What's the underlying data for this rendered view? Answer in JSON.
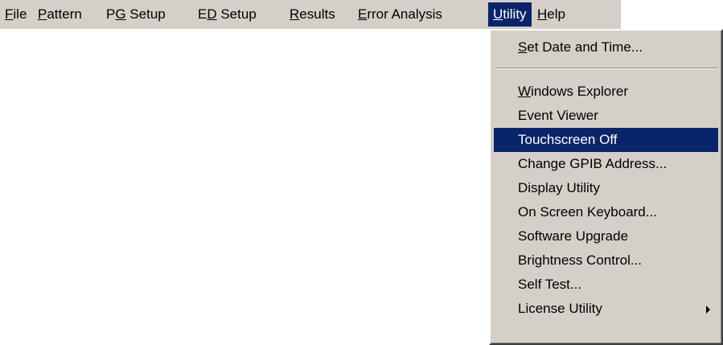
{
  "menubar": {
    "items": [
      {
        "first": "F",
        "rest": "ile"
      },
      {
        "first": "P",
        "rest": "attern"
      },
      {
        "pre": "P",
        "ul": "G",
        "post": " Setup"
      },
      {
        "pre": "E",
        "ul": "D",
        "post": " Setup"
      },
      {
        "first": "R",
        "rest": "esults"
      },
      {
        "first": "E",
        "rest": "rror Analysis"
      },
      {
        "first": "U",
        "rest": "tility"
      },
      {
        "first": "H",
        "rest": "elp"
      }
    ]
  },
  "dropdown": {
    "items": [
      {
        "first": "S",
        "rest": "et Date and Time..."
      },
      {
        "first": "W",
        "rest": "indows Explorer"
      },
      {
        "label": "Event Viewer"
      },
      {
        "label": "Touchscreen Off"
      },
      {
        "label": "Change GPIB Address..."
      },
      {
        "label": "Display Utility"
      },
      {
        "label": "On Screen Keyboard..."
      },
      {
        "label": "Software Upgrade"
      },
      {
        "label": "Brightness Control..."
      },
      {
        "label": "Self Test..."
      },
      {
        "label": "License Utility"
      }
    ],
    "highlighted": "Touchscreen Off",
    "submenu_icon": "submenu-arrow-icon"
  },
  "colors": {
    "menu_bg": "#d4d0c8",
    "highlight_bg": "#0a246a",
    "highlight_text": "#ffffff",
    "page_bg": "#ffffff"
  }
}
